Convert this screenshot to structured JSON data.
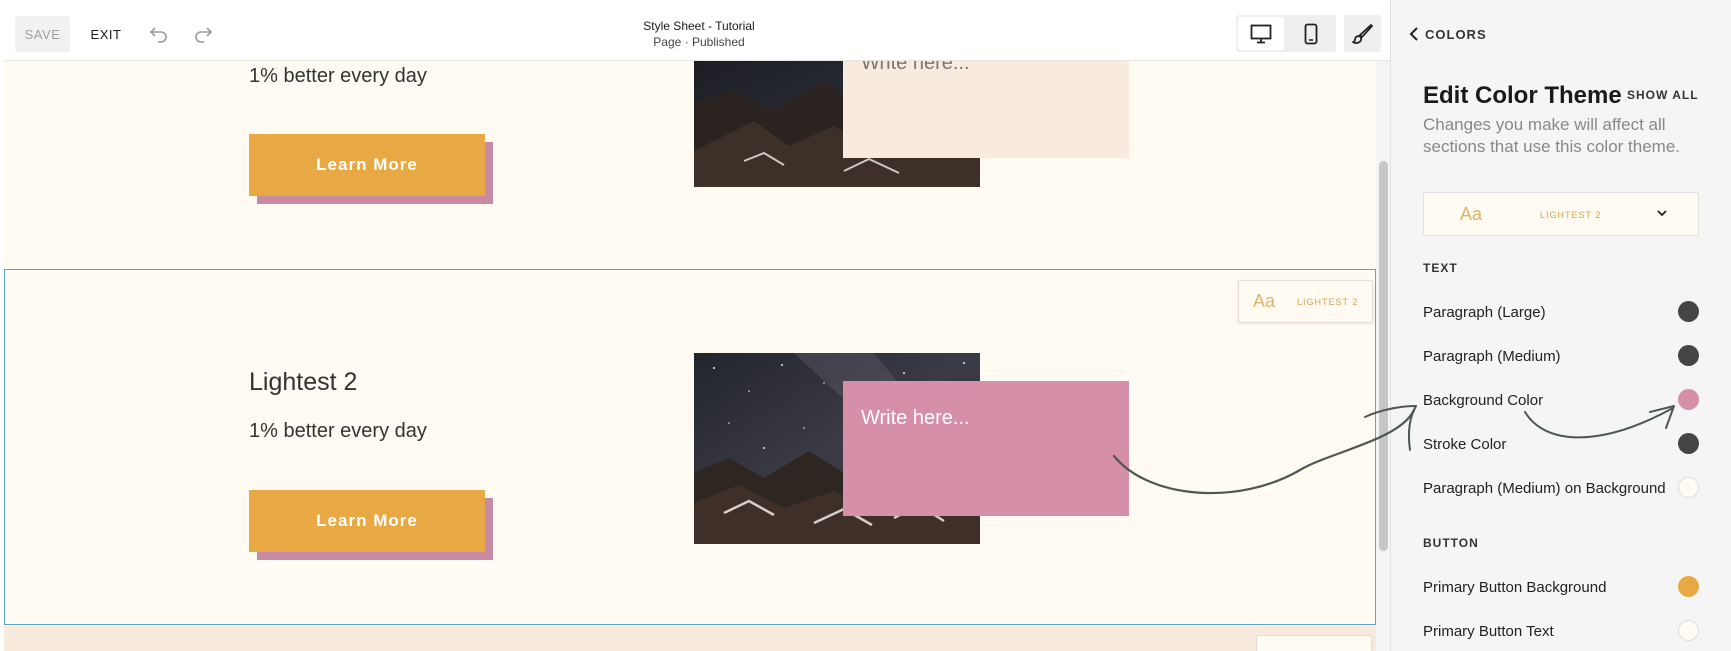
{
  "toolbar": {
    "save_label": "SAVE",
    "exit_label": "EXIT",
    "doc_title": "Style Sheet - Tutorial",
    "doc_status": "Page · Published"
  },
  "canvas": {
    "sections": [
      {
        "tagline": "1% better every day",
        "button_label": "Learn More",
        "note_text": "Write here..."
      },
      {
        "heading": "Lightest 2",
        "tagline": "1% better every day",
        "button_label": "Learn More",
        "note_text": "Write here..."
      }
    ],
    "theme_chip": {
      "sample": "Aa",
      "name": "LIGHTEST 2"
    }
  },
  "panel": {
    "back_label": "COLORS",
    "title": "Edit Color Theme",
    "show_all_label": "SHOW ALL",
    "description": "Changes you make will affect all sections that use this color theme.",
    "theme_select": {
      "sample": "Aa",
      "name": "LIGHTEST 2"
    },
    "text_group": {
      "heading": "TEXT",
      "items": [
        {
          "label": "Paragraph (Large)",
          "color": "#454545"
        },
        {
          "label": "Paragraph (Medium)",
          "color": "#454545"
        },
        {
          "label": "Background Color",
          "color": "#d68fa8"
        },
        {
          "label": "Stroke Color",
          "color": "#454545"
        },
        {
          "label": "Paragraph (Medium) on Background",
          "color": "#fffaf2"
        }
      ]
    },
    "button_group": {
      "heading": "BUTTON",
      "items": [
        {
          "label": "Primary Button Background",
          "color": "#e8a843"
        },
        {
          "label": "Primary Button Text",
          "color": "#fffaf2"
        }
      ]
    }
  },
  "colors": {
    "canvas_bg": "#fffaf2",
    "accent_orange": "#e8a843",
    "accent_pink": "#d68fa8",
    "selection_blue": "#5aa5c8"
  }
}
